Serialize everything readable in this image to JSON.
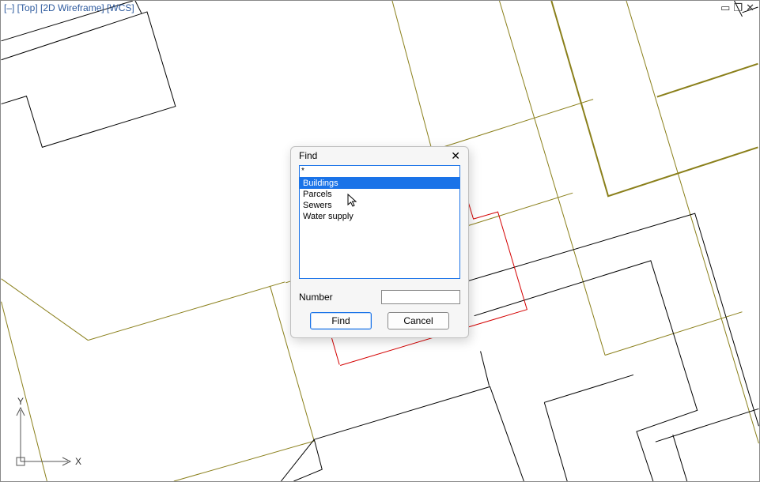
{
  "viewport": {
    "label": "[–] [Top] [2D Wireframe] [WCS]"
  },
  "ucs": {
    "x_label": "X",
    "y_label": "Y"
  },
  "dialog": {
    "title": "Find",
    "search_value": "*",
    "list": [
      "Buildings",
      "Parcels",
      "Sewers",
      "Water supply"
    ],
    "selected_index": 0,
    "number_label": "Number",
    "number_value": "",
    "find_label": "Find",
    "cancel_label": "Cancel"
  },
  "colors": {
    "olive": "#8a7f1a",
    "red": "#d40000",
    "black": "#000000",
    "selection": "#1a73e8"
  }
}
